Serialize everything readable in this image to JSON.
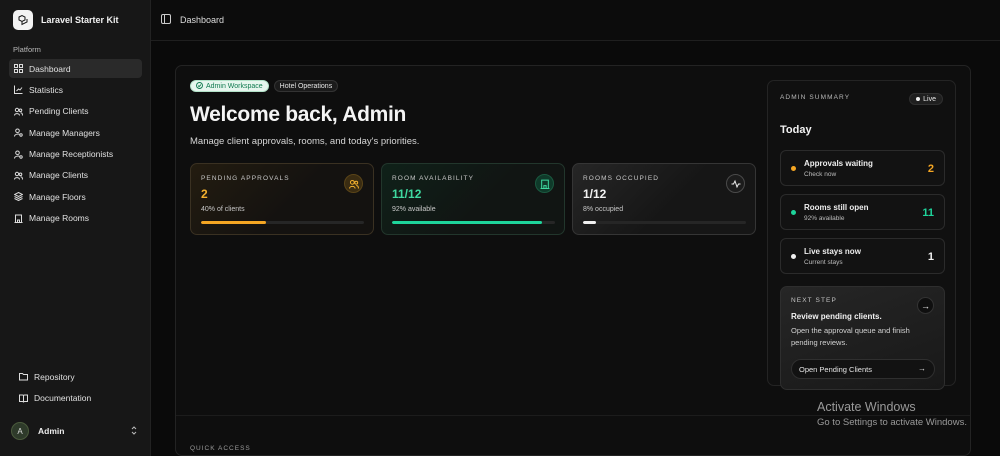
{
  "app": {
    "name": "Laravel Starter Kit"
  },
  "sidebar": {
    "section_label": "Platform",
    "items": [
      {
        "label": "Dashboard",
        "icon": "grid-icon",
        "active": true
      },
      {
        "label": "Statistics",
        "icon": "chart-icon"
      },
      {
        "label": "Pending Clients",
        "icon": "users-icon"
      },
      {
        "label": "Manage Managers",
        "icon": "user-cog-icon"
      },
      {
        "label": "Manage Receptionists",
        "icon": "user-cog-icon"
      },
      {
        "label": "Manage Clients",
        "icon": "users-icon"
      },
      {
        "label": "Manage Floors",
        "icon": "layers-icon"
      },
      {
        "label": "Manage Rooms",
        "icon": "building-icon"
      }
    ],
    "footer_items": [
      {
        "label": "Repository",
        "icon": "folder-icon"
      },
      {
        "label": "Documentation",
        "icon": "book-icon"
      }
    ],
    "user": {
      "initial": "A",
      "name": "Admin"
    }
  },
  "topbar": {
    "breadcrumb": "Dashboard"
  },
  "main": {
    "badges": {
      "workspace": "Admin Workspace",
      "operations": "Hotel Operations"
    },
    "welcome": "Welcome back, Admin",
    "subtitle": "Manage client approvals, rooms, and today's priorities.",
    "stats": [
      {
        "label": "PENDING APPROVALS",
        "value": "2",
        "sub": "40% of clients",
        "progress": 0.4,
        "icon": "users-icon",
        "accent": "#f5a623"
      },
      {
        "label": "ROOM AVAILABILITY",
        "value": "11/12",
        "sub": "92% available",
        "progress": 0.92,
        "icon": "building-icon",
        "accent": "#1ed49b"
      },
      {
        "label": "ROOMS OCCUPIED",
        "value": "1/12",
        "sub": "8% occupied",
        "progress": 0.08,
        "icon": "activity-icon",
        "accent": "#f0f0f0"
      }
    ],
    "quick_access": "QUICK ACCESS"
  },
  "summary": {
    "eyebrow": "ADMIN SUMMARY",
    "live": "Live",
    "title": "Today",
    "rows": [
      {
        "title": "Approvals waiting",
        "sub": "Check now",
        "value": "2",
        "color": "#f5a623"
      },
      {
        "title": "Rooms still open",
        "sub": "92% available",
        "value": "11",
        "color": "#1ed49b"
      },
      {
        "title": "Live stays now",
        "sub": "Current stays",
        "value": "1",
        "color": "#f0f0f0"
      }
    ],
    "next_step": {
      "eyebrow": "NEXT STEP",
      "title": "Review pending clients.",
      "desc": "Open the approval queue and finish pending reviews.",
      "button": "Open Pending Clients"
    }
  },
  "watermark": {
    "line1": "Activate Windows",
    "line2": "Go to Settings to activate Windows."
  }
}
